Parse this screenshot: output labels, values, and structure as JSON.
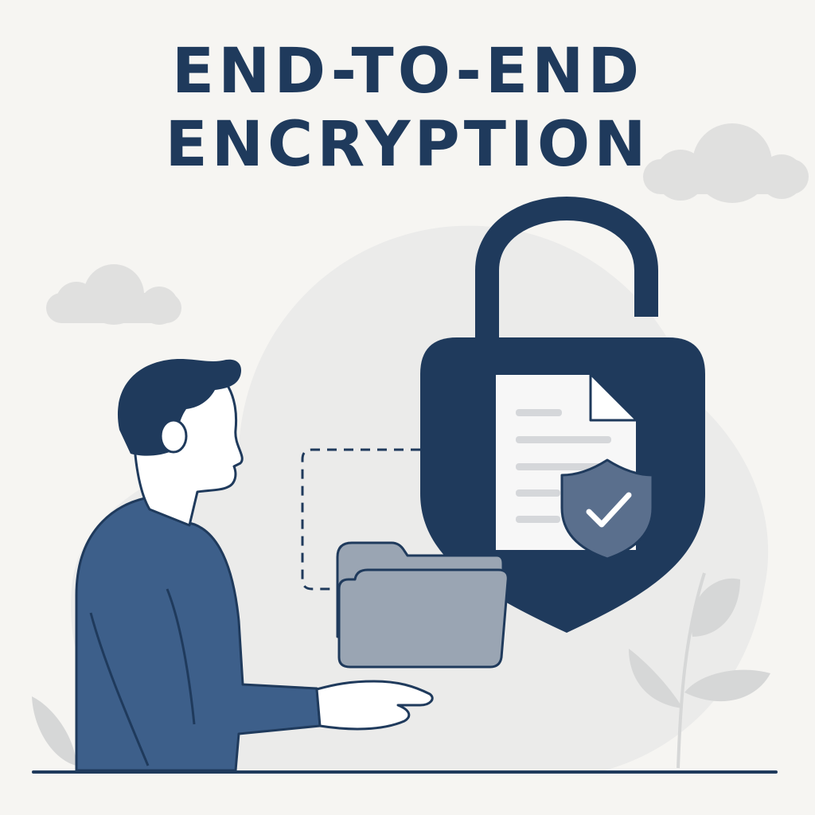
{
  "title": {
    "line1": "END-TO-END",
    "line2": "ENCRYPTION"
  },
  "colors": {
    "background": "#f6f5f2",
    "navy": "#1f3a5c",
    "shirt_blue": "#3d5f8a",
    "folder_gray": "#9aa5b3",
    "blob_gray": "#ebebea",
    "cloud_gray": "#e0e0df",
    "leaf_gray": "#d6d7d7",
    "document_white": "#f7f7f7",
    "document_lines": "#d5d7da",
    "shield_slate": "#5a6f8d"
  },
  "icons": {
    "padlock": "open-padlock-icon",
    "document": "document-icon",
    "shield": "shield-check-icon",
    "folder": "folder-icon"
  }
}
